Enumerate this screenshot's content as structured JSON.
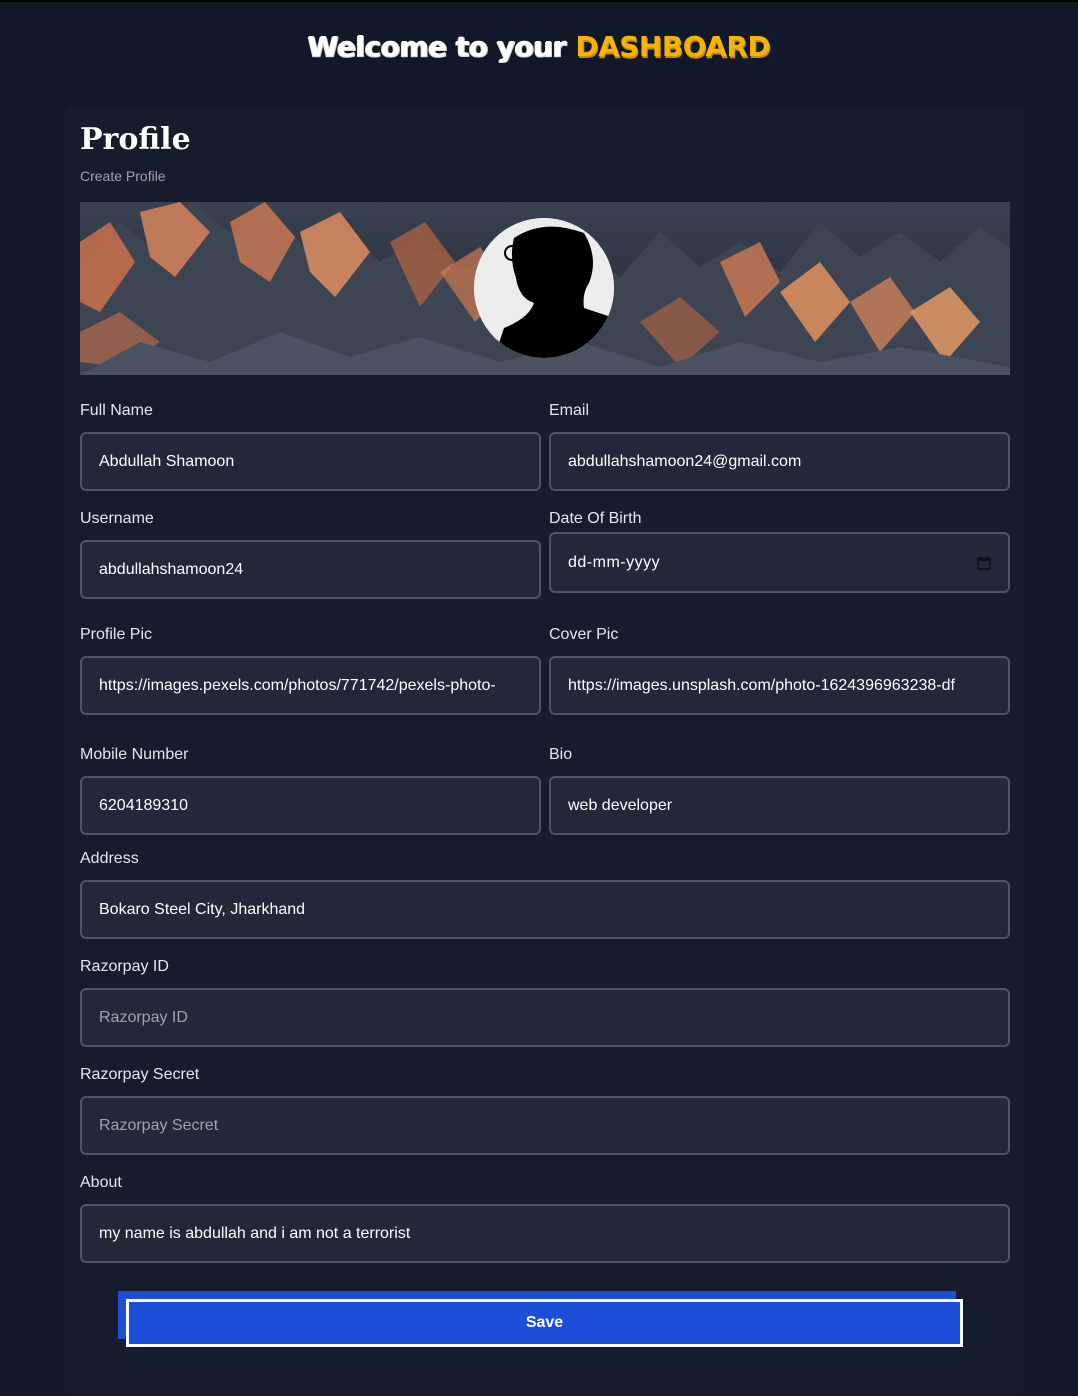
{
  "header": {
    "welcome_prefix": "Welcome to your ",
    "welcome_accent": "DASHBOARD",
    "accent_color": "#f5b400"
  },
  "card": {
    "title": "Profile",
    "subtitle": "Create Profile"
  },
  "cover": {
    "icon": "mountain-cover-image"
  },
  "avatar": {
    "icon": "silhouette-avatar-image"
  },
  "fields": {
    "full_name": {
      "label": "Full Name",
      "value": "Abdullah Shamoon"
    },
    "email": {
      "label": "Email",
      "value": "abdullahshamoon24@gmail.com"
    },
    "username": {
      "label": "Username",
      "value": "abdullahshamoon24"
    },
    "dob": {
      "label": "Date Of Birth",
      "value": "dd-mm-yyyy",
      "icon": "calendar-icon"
    },
    "profile_pic": {
      "label": "Profile Pic",
      "value": "https://images.pexels.com/photos/771742/pexels-photo-"
    },
    "cover_pic": {
      "label": "Cover Pic",
      "value": "https://images.unsplash.com/photo-1624396963238-df"
    },
    "mobile": {
      "label": "Mobile Number",
      "value": "6204189310"
    },
    "bio": {
      "label": "Bio",
      "value": "web developer"
    },
    "address": {
      "label": "Address",
      "value": "Bokaro Steel City, Jharkhand"
    },
    "razorpay_id": {
      "label": "Razorpay ID",
      "placeholder": "Razorpay ID"
    },
    "razorpay_secret": {
      "label": "Razorpay Secret",
      "placeholder": "Razorpay Secret"
    },
    "about": {
      "label": "About",
      "value": "my name is abdullah and i am not a terrorist"
    }
  },
  "save": {
    "label": "Save",
    "color": "#1d4ed8"
  }
}
